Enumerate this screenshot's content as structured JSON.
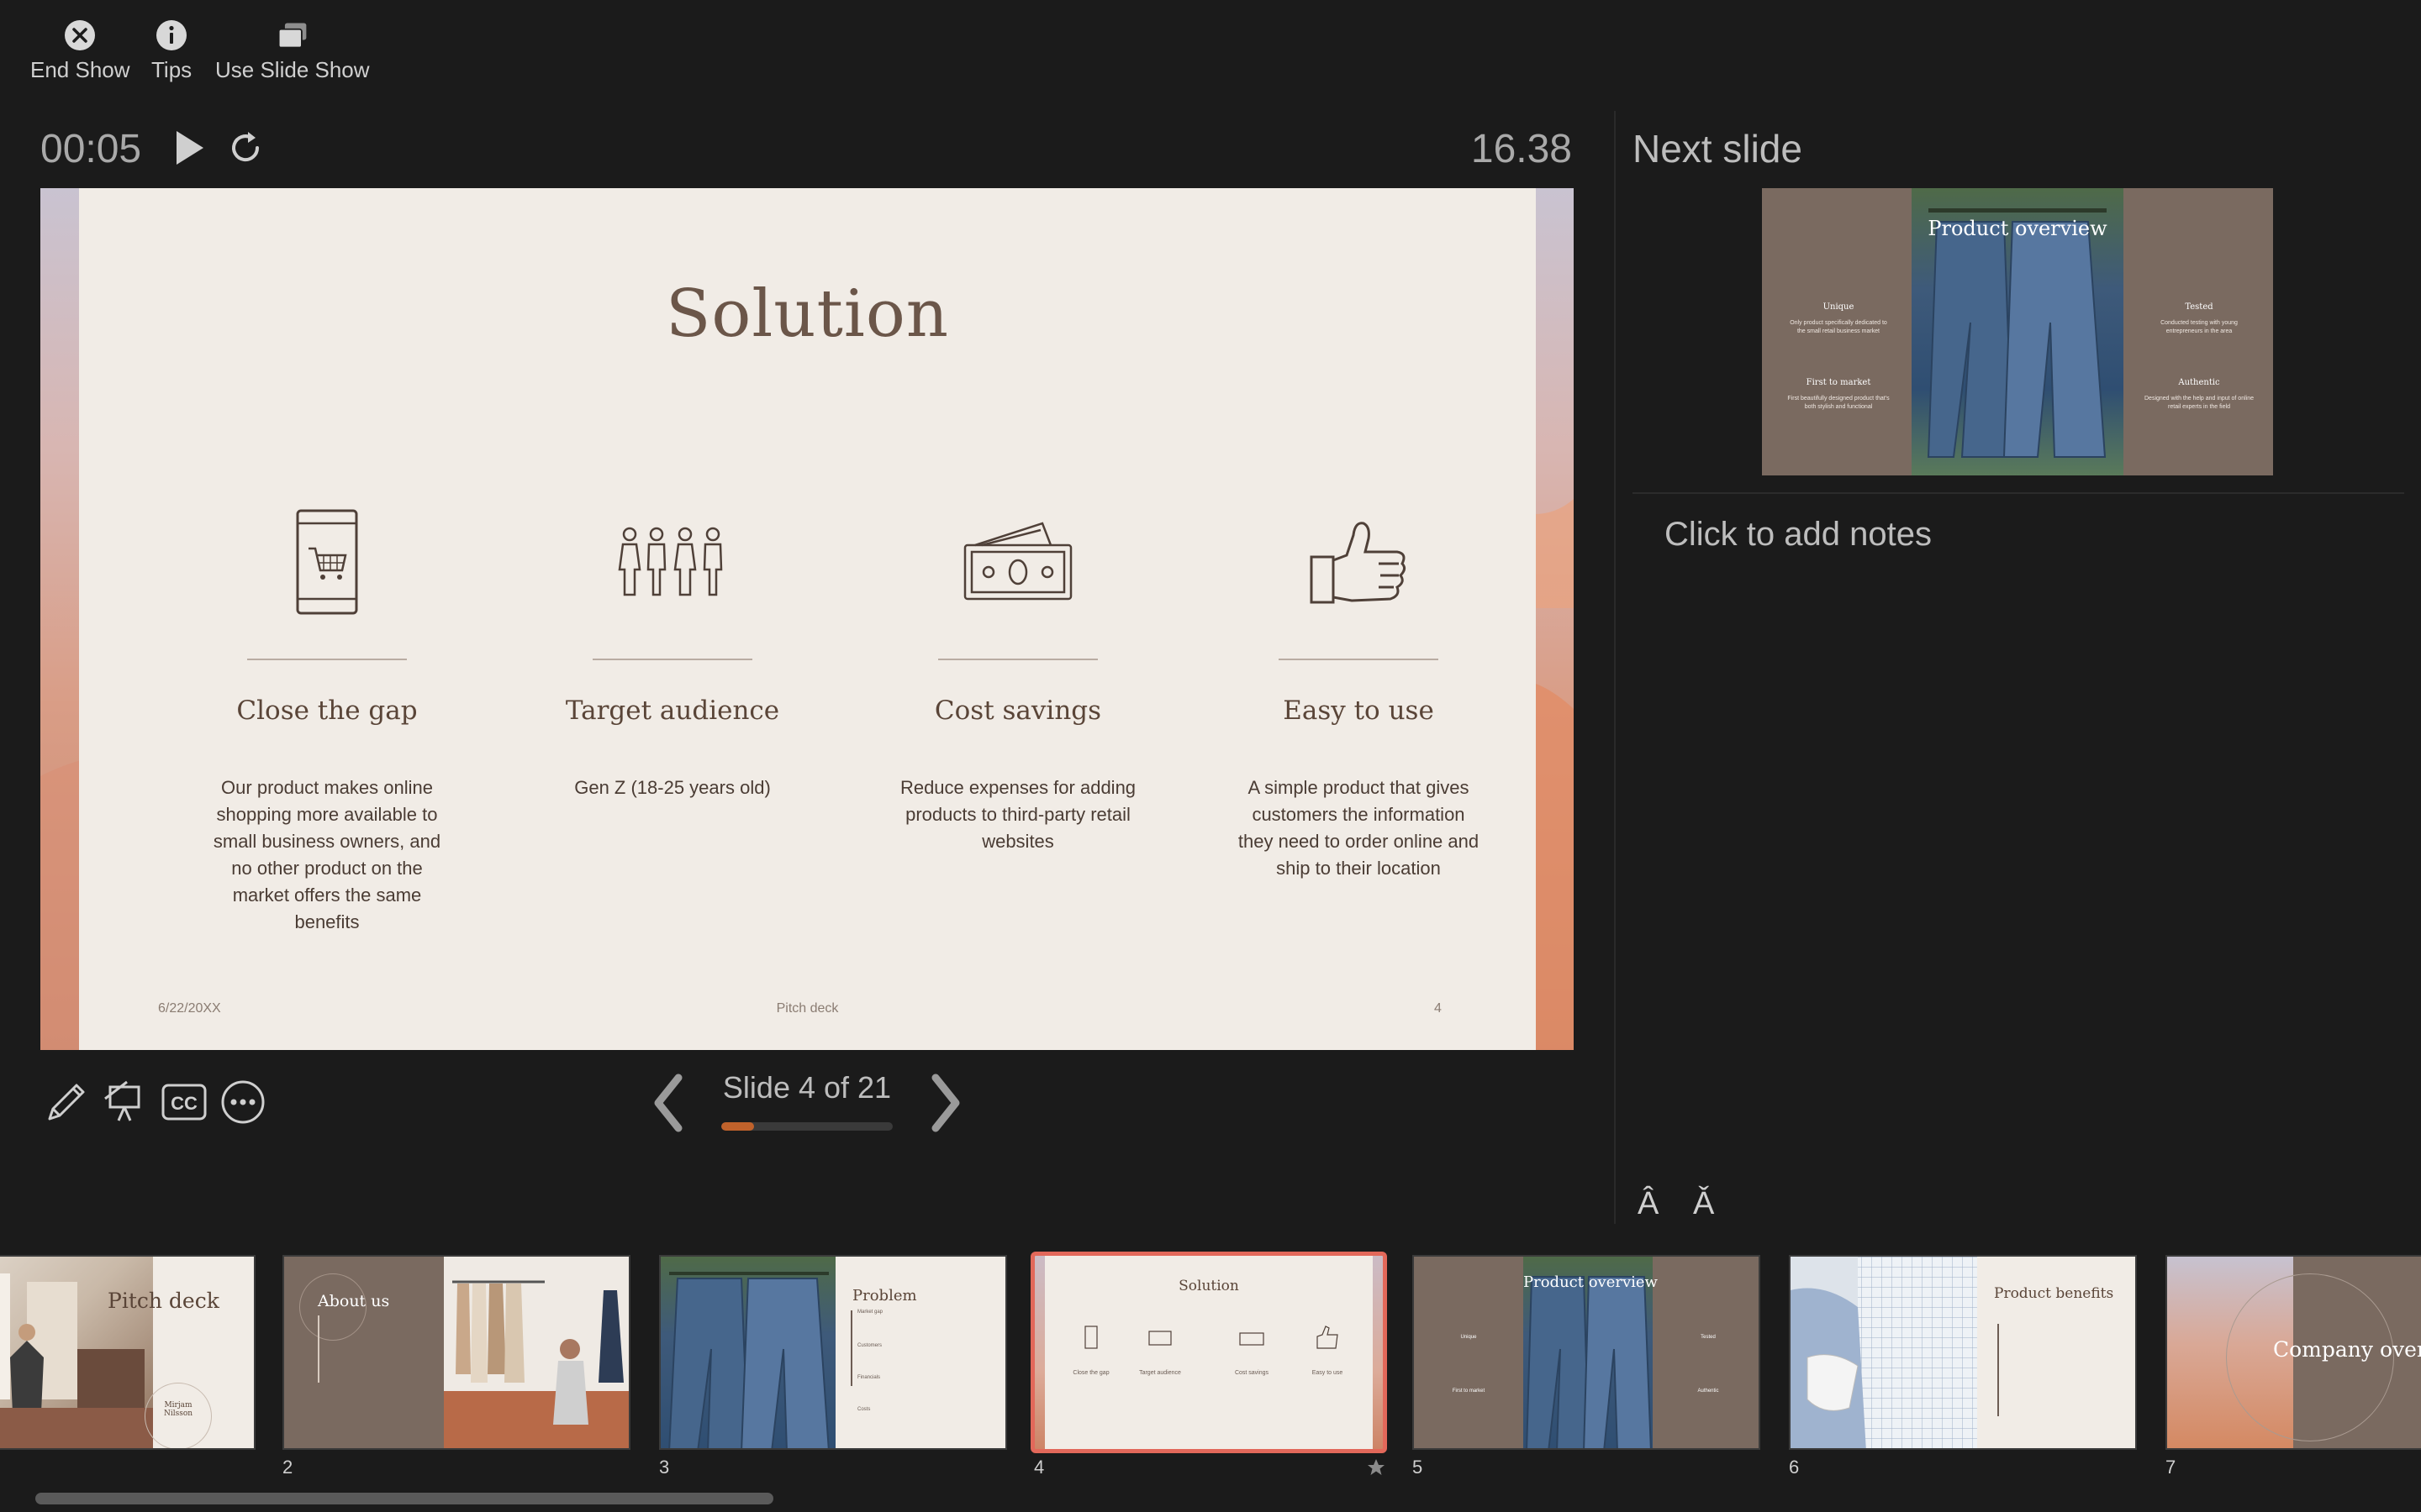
{
  "toolbar": {
    "end_show": "End Show",
    "tips": "Tips",
    "use_slide_show": "Use Slide Show"
  },
  "timer": {
    "elapsed": "00:05",
    "clock": "16.38"
  },
  "slide": {
    "title": "Solution",
    "columns": [
      {
        "icon": "phone-cart-icon",
        "heading": "Close the gap",
        "body": "Our product makes online shopping more available to small business owners, and no other product on the market offers the same benefits"
      },
      {
        "icon": "people-group-icon",
        "heading": "Target audience",
        "body": "Gen Z (18-25 years old)"
      },
      {
        "icon": "money-stack-icon",
        "heading": "Cost savings",
        "body": "Reduce expenses for adding products to third-party retail websites"
      },
      {
        "icon": "thumbs-up-icon",
        "heading": "Easy to use",
        "body": "A simple product that gives customers the information they need to order online and ship to their location"
      }
    ],
    "footer_date": "6/22/20XX",
    "footer_center": "Pitch deck",
    "footer_page": "4"
  },
  "navigation": {
    "slide_label": "Slide 4 of 21",
    "progress_fraction": 0.19
  },
  "next_slide": {
    "label": "Next slide",
    "title": "Product overview",
    "left_blocks": [
      {
        "heading": "Unique",
        "text": "Only product specifically dedicated to the small retail business market"
      },
      {
        "heading": "First to market",
        "text": "First beautifully designed product that's both stylish and functional"
      }
    ],
    "right_blocks": [
      {
        "heading": "Tested",
        "text": "Conducted testing with young entrepreneurs in the area"
      },
      {
        "heading": "Authentic",
        "text": "Designed with the help and input of online retail experts in the field"
      }
    ]
  },
  "notes": {
    "placeholder": "Click to add notes"
  },
  "font_controls": {
    "increase": "Â",
    "decrease": "Ǎ"
  },
  "thumbnails": [
    {
      "num": "",
      "title": "Pitch deck",
      "subtitle": "Mirjam Nilsson"
    },
    {
      "num": "2",
      "title": "About us"
    },
    {
      "num": "3",
      "title": "Problem",
      "items": [
        "Market gap",
        "Customers",
        "Financials",
        "Costs"
      ]
    },
    {
      "num": "4",
      "title": "Solution",
      "items": [
        "Close the gap",
        "Target audience",
        "Cost savings",
        "Easy to use"
      ]
    },
    {
      "num": "5",
      "title": "Product overview",
      "items": [
        "Unique",
        "First to market",
        "Tested",
        "Authentic"
      ]
    },
    {
      "num": "6",
      "title": "Product benefits"
    },
    {
      "num": "7",
      "title": "Company overv"
    }
  ],
  "colors": {
    "accent": "#e2685a",
    "progress": "#c0622b",
    "slide_text": "#5a4538",
    "slide_bg": "#f1ece6"
  }
}
